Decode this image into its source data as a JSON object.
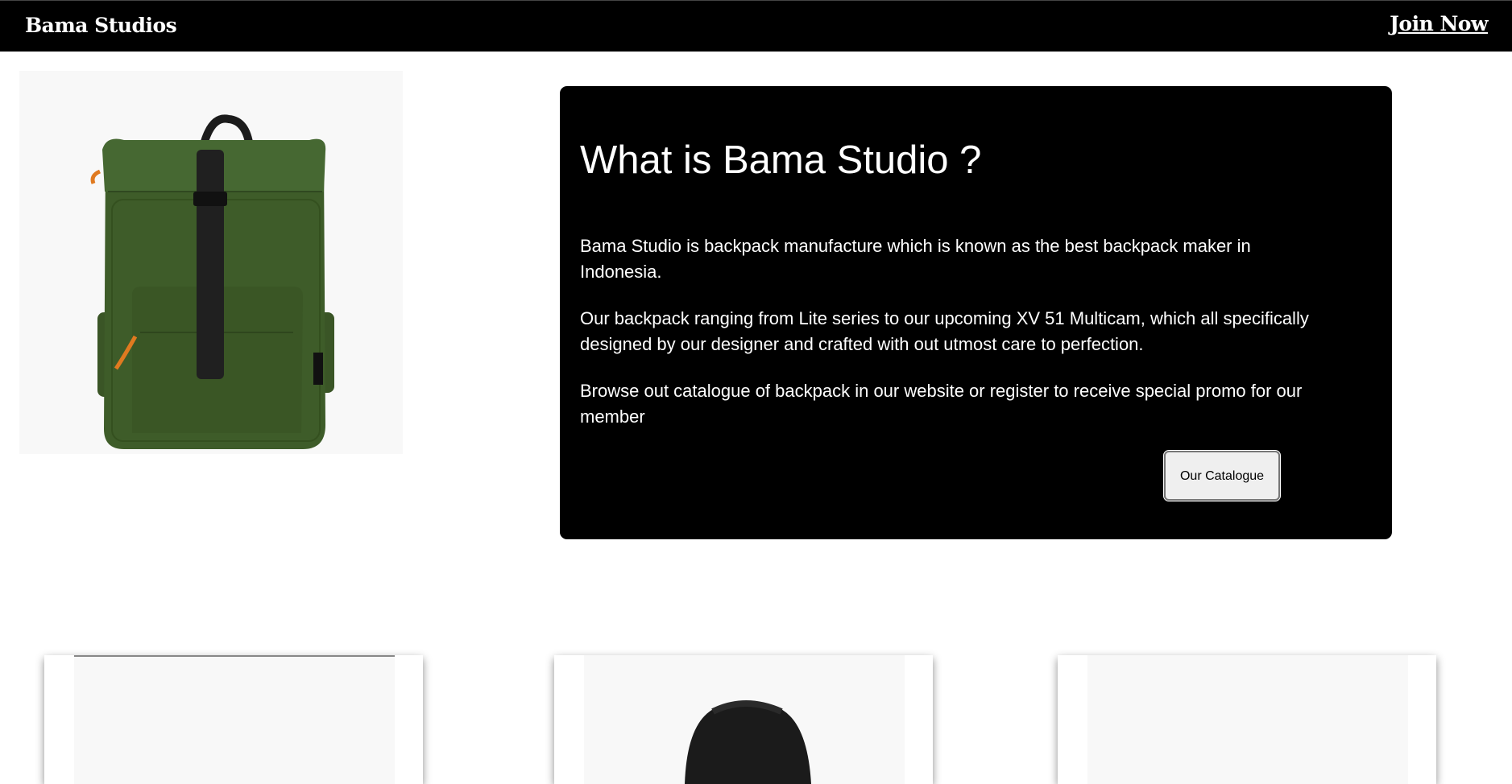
{
  "header": {
    "brand": "Bama Studios",
    "join_label": "Join Now"
  },
  "hero": {
    "image_alt": "green-roll-top-backpack"
  },
  "info": {
    "title": "What is Bama Studio ?",
    "paragraphs": [
      "Bama Studio is backpack manufacture which is known as the best backpack maker in Indonesia.",
      "Our backpack ranging from Lite series to our upcoming XV 51 Multicam, which all specifically designed by our designer and crafted with out utmost care to perfection.",
      "Browse out catalogue of backpack in our website or register to receive special promo for our member"
    ],
    "button_label": "Our Catalogue"
  },
  "products": [
    {
      "image": "product-image-placeholder"
    },
    {
      "image": "black-backpack"
    },
    {
      "image": "product-image-placeholder"
    }
  ],
  "colors": {
    "header_bg": "#000000",
    "card_bg": "#000000",
    "text_light": "#ffffff",
    "backpack_green": "#3d5a28"
  }
}
